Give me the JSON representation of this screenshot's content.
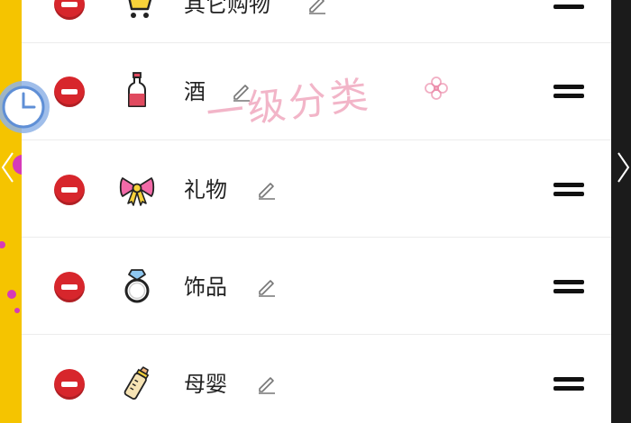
{
  "watermark": "一级分类",
  "categories": [
    {
      "label": "其它购物",
      "icon": "shopping-cart-icon"
    },
    {
      "label": "酒",
      "icon": "wine-bottle-icon"
    },
    {
      "label": "礼物",
      "icon": "bow-icon"
    },
    {
      "label": "饰品",
      "icon": "ring-icon"
    },
    {
      "label": "母婴",
      "icon": "baby-bottle-icon"
    }
  ],
  "colors": {
    "delete_red": "#d7262c",
    "left_edge": "#f5c400",
    "right_edge": "#1b1b1b",
    "watermark_pink": "#e8789b"
  }
}
